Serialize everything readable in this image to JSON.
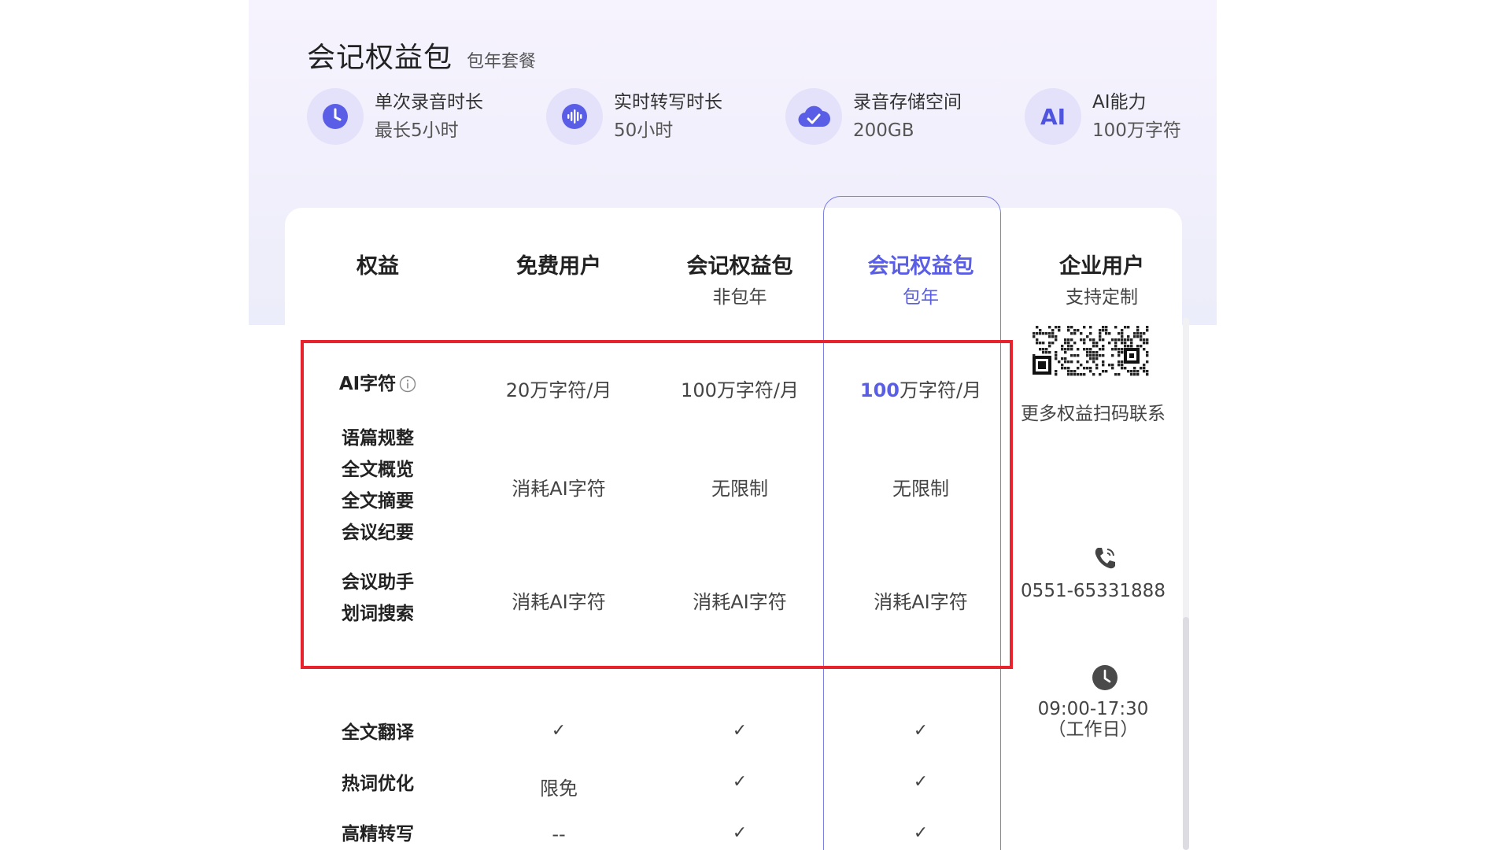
{
  "header": {
    "title": "会记权益包",
    "subtitle": "包年套餐"
  },
  "features": [
    {
      "icon": "clock-icon",
      "label": "单次录音时长",
      "value": "最长5小时"
    },
    {
      "icon": "soundwave-icon",
      "label": "实时转写时长",
      "value": "50小时"
    },
    {
      "icon": "cloud-check-icon",
      "label": "录音存储空间",
      "value": "200GB"
    },
    {
      "icon": "ai-icon",
      "icon_text": "AI",
      "label": "AI能力",
      "value": "100万字符"
    }
  ],
  "columns": [
    {
      "title": "权益",
      "sub": ""
    },
    {
      "title": "免费用户",
      "sub": ""
    },
    {
      "title": "会记权益包",
      "sub": "非包年"
    },
    {
      "title": "会记权益包",
      "sub": "包年"
    },
    {
      "title": "企业用户",
      "sub": "支持定制"
    }
  ],
  "rows": {
    "ai_chars": {
      "label": "AI字符",
      "free": "20万字符/月",
      "nonyear": "100万字符/月",
      "year_num": "100",
      "year_rest": "万字符/月"
    },
    "group1": {
      "labels": [
        "语篇规整",
        "全文概览",
        "全文摘要",
        "会议纪要"
      ],
      "free": "消耗AI字符",
      "nonyear": "无限制",
      "year": "无限制"
    },
    "group2": {
      "labels": [
        "会议助手",
        "划词搜索"
      ],
      "free": "消耗AI字符",
      "nonyear": "消耗AI字符",
      "year": "消耗AI字符"
    },
    "translate": {
      "label": "全文翻译",
      "free": "✓",
      "nonyear": "✓",
      "year": "✓"
    },
    "hotword": {
      "label": "热词优化",
      "free": "限免",
      "nonyear": "✓",
      "year": "✓"
    },
    "hq": {
      "label": "高精转写",
      "free": "--",
      "nonyear": "✓",
      "year": "✓"
    }
  },
  "enterprise": {
    "qr_caption": "更多权益扫码联系",
    "phone": "0551-65331888",
    "hours": "09:00-17:30",
    "hours_note": "（工作日）"
  },
  "colors": {
    "accent": "#5a5ee6",
    "highlight_box": "#e8232d"
  }
}
